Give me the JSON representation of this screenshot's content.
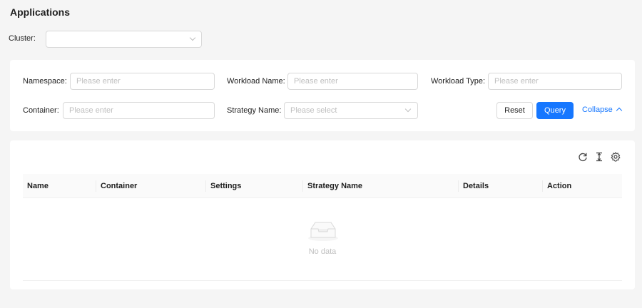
{
  "page": {
    "title": "Applications"
  },
  "cluster": {
    "label": "Cluster:",
    "value": ""
  },
  "filters": {
    "namespace": {
      "label": "Namespace:",
      "placeholder": "Please enter"
    },
    "workload_name": {
      "label": "Workload Name:",
      "placeholder": "Please enter"
    },
    "workload_type": {
      "label": "Workload Type:",
      "placeholder": "Please enter"
    },
    "container": {
      "label": "Container:",
      "placeholder": "Please enter"
    },
    "strategy_name": {
      "label": "Strategy Name:",
      "placeholder": "Please select"
    }
  },
  "actions": {
    "reset": "Reset",
    "query": "Query",
    "collapse": "Collapse"
  },
  "table": {
    "toolbar_icons": [
      "reload-icon",
      "density-icon",
      "settings-icon"
    ],
    "columns": [
      "Name",
      "Container",
      "Settings",
      "Strategy Name",
      "Details",
      "Action"
    ],
    "rows": [],
    "empty_text": "No data"
  },
  "colors": {
    "primary": "#1677ff",
    "background": "#f5f5f5"
  }
}
